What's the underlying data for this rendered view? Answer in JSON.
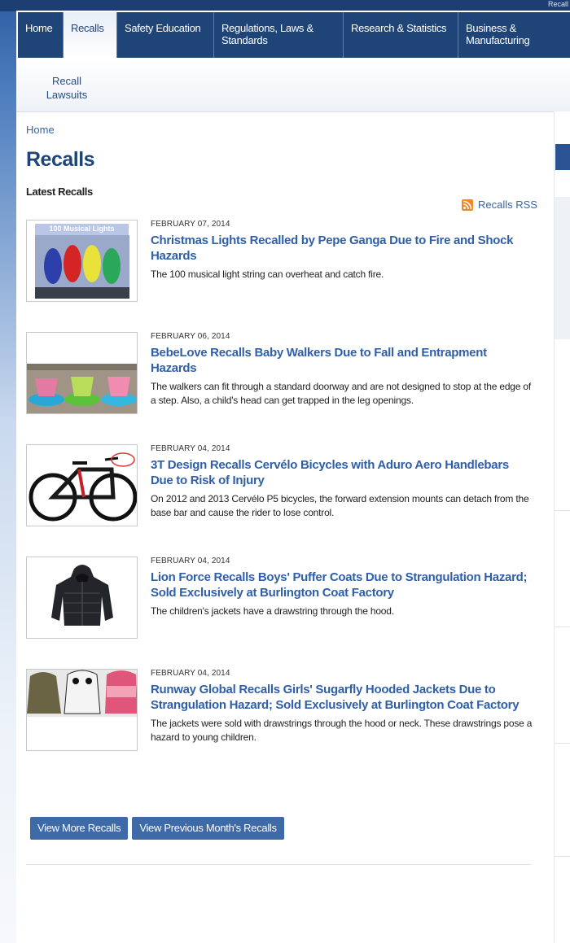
{
  "top_strip": {
    "text": "Recall"
  },
  "nav": {
    "items": [
      {
        "label": "Home"
      },
      {
        "label": "Recalls"
      },
      {
        "label": "Safety Education"
      },
      {
        "label": "Regulations, Laws & Standards"
      },
      {
        "label": "Research & Statistics"
      },
      {
        "label": "Business & Manufacturing"
      }
    ]
  },
  "subnav": {
    "label": "Recall Lawsuits"
  },
  "breadcrumb": "Home",
  "page_title": "Recalls",
  "section_title": "Latest Recalls",
  "rss_label": "Recalls RSS",
  "recalls": [
    {
      "date": "FEBRUARY 07, 2014",
      "title": "Christmas Lights Recalled by Pepe Ganga Due to Fire and Shock Hazards",
      "description": "The 100 musical light string can overheat and catch fire.",
      "image_caption": "100 Musical Lights",
      "image": "christmas-lights-box"
    },
    {
      "date": "FEBRUARY 06, 2014",
      "title": "BebeLove Recalls Baby Walkers Due to Fall and Entrapment Hazards",
      "description": "The walkers can fit through a standard doorway and are not designed to stop at the edge of a step. Also, a child's head can get trapped in the leg openings.",
      "image": "baby-walkers"
    },
    {
      "date": "FEBRUARY 04, 2014",
      "title": "3T Design Recalls Cervélo Bicycles with Aduro Aero Handlebars Due to Risk of Injury",
      "description": "On 2012 and 2013 Cervélo P5 bicycles, the forward extension mounts can detach from the base bar and cause the rider to lose control.",
      "image": "bicycle"
    },
    {
      "date": "FEBRUARY 04, 2014",
      "title": "Lion Force Recalls Boys' Puffer Coats Due to Strangulation Hazard; Sold Exclusively at Burlington Coat Factory",
      "description": "The children's jackets have a drawstring through the hood.",
      "image": "puffer-coat"
    },
    {
      "date": "FEBRUARY 04, 2014",
      "title": "Runway Global Recalls Girls' Sugarfly Hooded Jackets Due to Strangulation Hazard; Sold Exclusively at Burlington Coat Factory",
      "description": "The jackets were sold with drawstrings through the hood or neck. These drawstrings pose a hazard to young children.",
      "image": "hooded-jackets"
    }
  ],
  "buttons": {
    "more": "View More Recalls",
    "previous": "View Previous Month's Recalls"
  },
  "colors": {
    "nav_bg": "#1f4578",
    "link": "#2f5fa8",
    "button": "#3e6aa8",
    "rss": "#f0882b"
  }
}
